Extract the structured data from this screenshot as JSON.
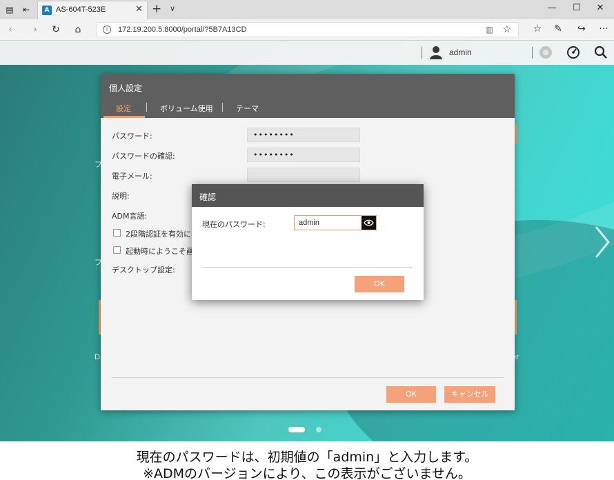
{
  "browser": {
    "tab_title": "AS-604T-523E",
    "url": "172.19.200.5:8000/portal/?5B7A13CD"
  },
  "adm": {
    "user_name": "admin",
    "bg_labels": [
      "フ",
      "D",
      "er"
    ]
  },
  "personal_window": {
    "title": "個人設定",
    "tabs": [
      "設定",
      "ボリューム使用",
      "テーマ"
    ],
    "fields": {
      "password_label": "パスワード:",
      "password_value": "••••••••",
      "password_confirm_label": "パスワードの確認:",
      "password_confirm_value": "••••••••",
      "email_label": "電子メール:",
      "email_value": "",
      "description_label": "説明:",
      "language_label": "ADM言語:",
      "two_step_label": "2段階認証を有効にする",
      "welcome_label": "起動時にようこそ画面を表示",
      "desktop_label": "デスクトップ設定:"
    },
    "ok_label": "OK",
    "cancel_label": "キャンセル"
  },
  "confirm_dialog": {
    "title": "確認",
    "current_password_label": "現在のパスワード:",
    "current_password_value": "admin",
    "ok_label": "OK"
  },
  "caption": {
    "line1": "現在のパスワードは、初期値の「admin」と入力します。",
    "line2": "※ADMのバージョンにより、この表示がございません。"
  },
  "colors": {
    "accent": "#f39c6b",
    "button": "#f4a27a",
    "window_header": "#5f5f5f",
    "dialog_header": "#555555"
  }
}
